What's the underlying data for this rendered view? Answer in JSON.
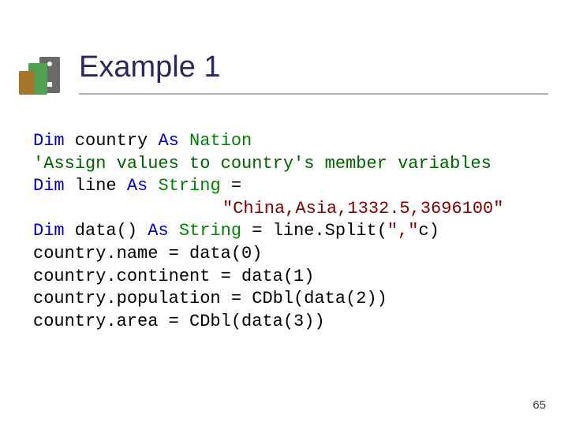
{
  "title": "Example 1",
  "code": {
    "l1_kw1": "Dim",
    "l1_txt1": " country ",
    "l1_kw2": "As",
    "l1_txt2": " ",
    "l1_ty": "Nation",
    "l2_cm": "'Assign values to country's member variables",
    "l3_kw1": "Dim",
    "l3_txt1": " line ",
    "l3_kw2": "As",
    "l3_txt2": " ",
    "l3_ty": "String",
    "l3_txt3": " =",
    "l4_str": "\"China,Asia,1332.5,3696100\"",
    "l5_kw1": "Dim",
    "l5_txt1": " data() ",
    "l5_kw2": "As",
    "l5_txt2": " ",
    "l5_ty": "String",
    "l5_txt3": " = line.Split(",
    "l5_str": "\",\"",
    "l5_txt4": "c)",
    "l6": "country.name = data(0)",
    "l7": "country.continent = data(1)",
    "l8": "country.population = CDbl(data(2))",
    "l9": "country.area = CDbl(data(3))"
  },
  "page_number": "65"
}
